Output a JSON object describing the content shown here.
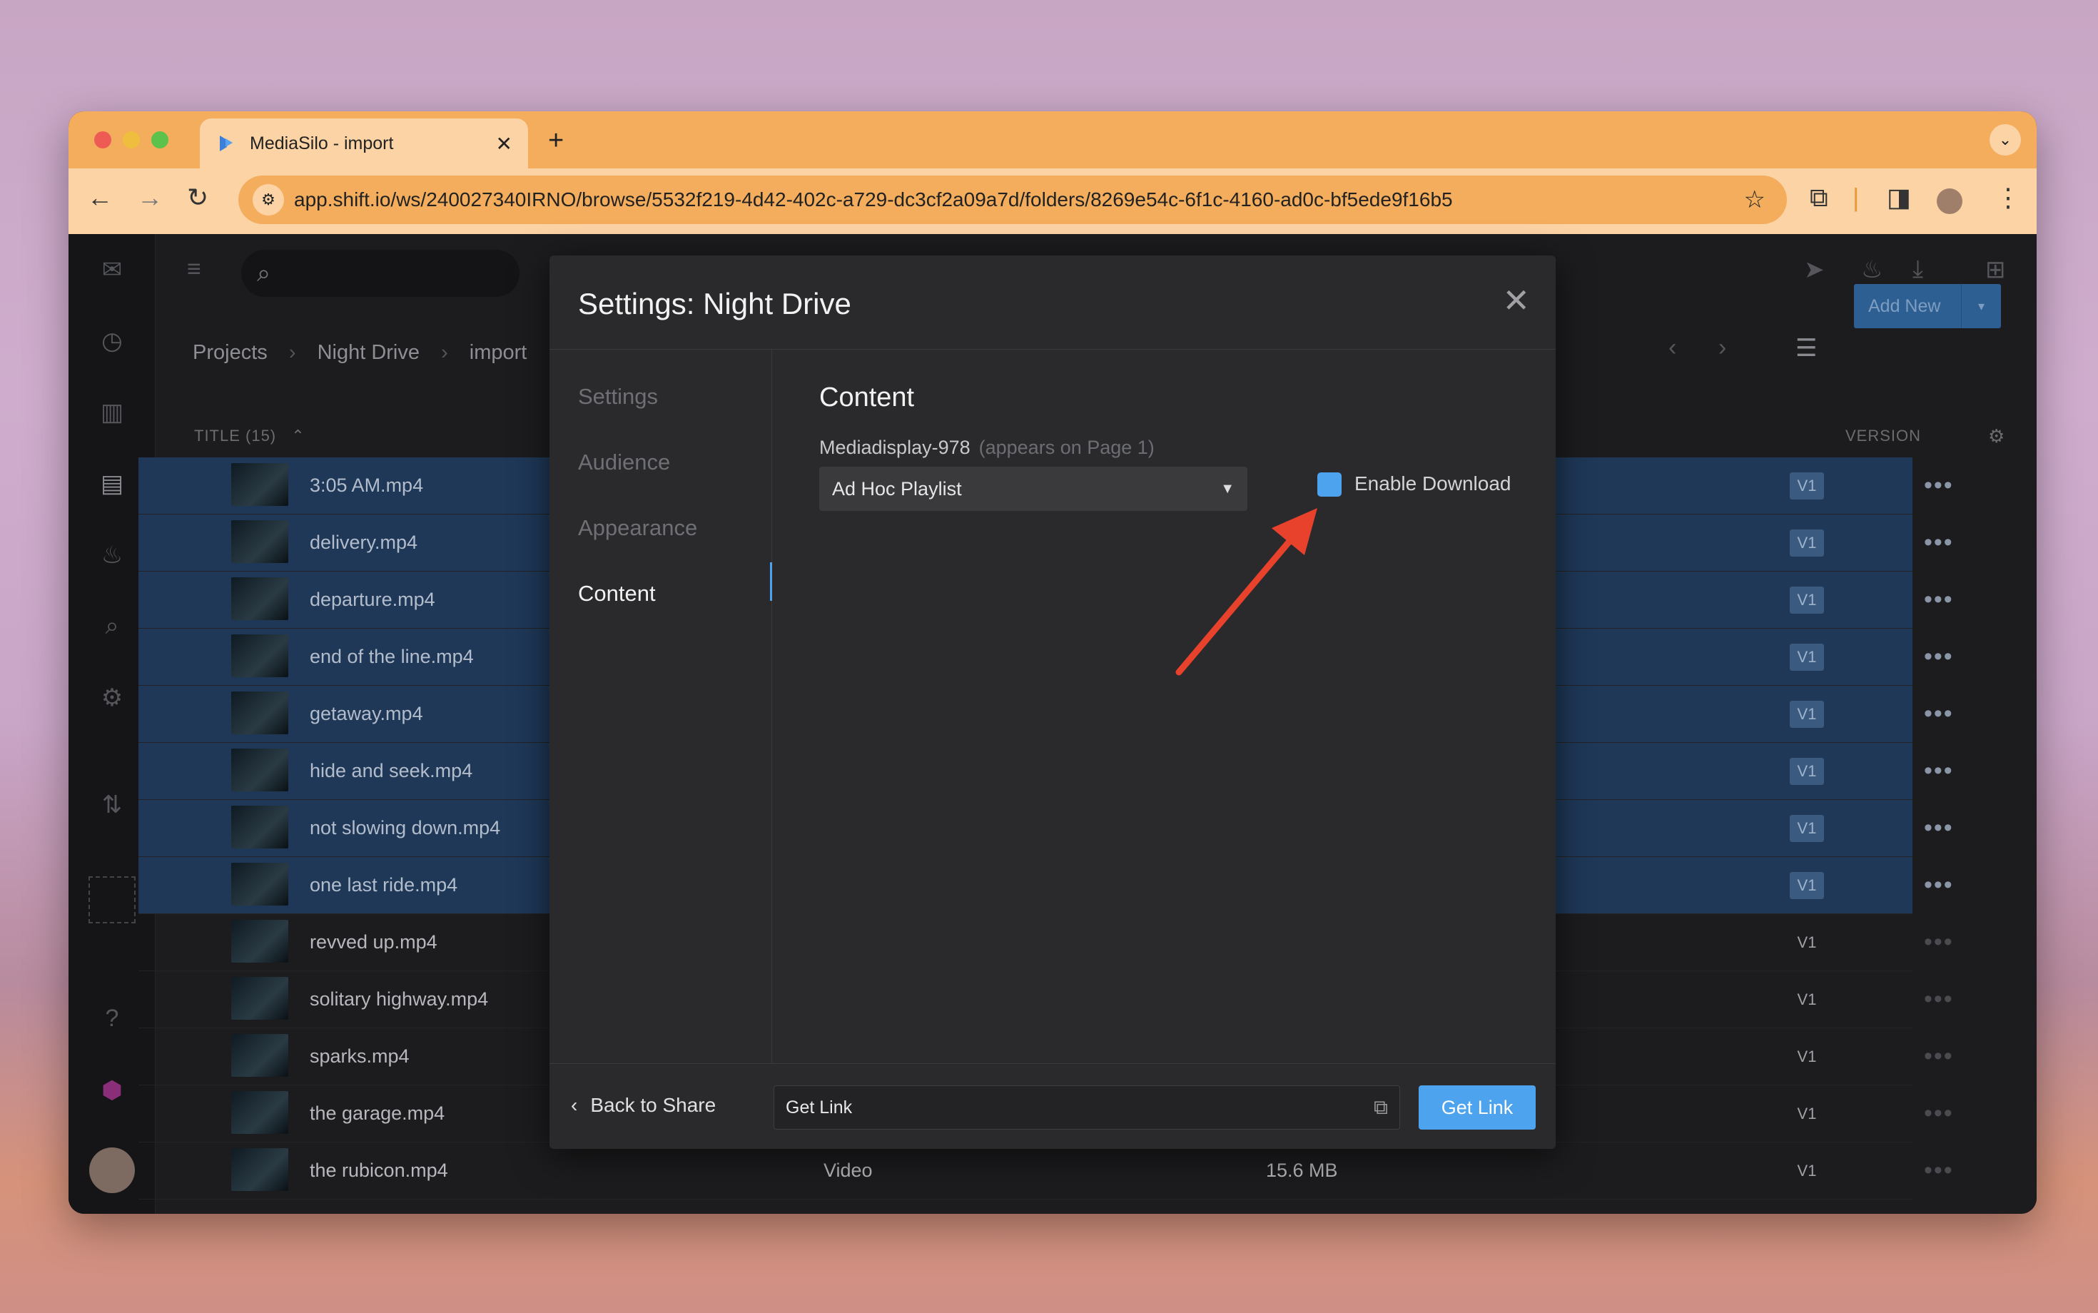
{
  "browser": {
    "tab_title": "MediaSilo - import",
    "tab_close": "✕",
    "new_tab": "+",
    "url": "app.shift.io/ws/240027340IRNO/browse/5532f219-4d42-402c-a729-dc3cf2a09a7d/folders/8269e54c-6f1c-4160-ad0c-bf5ede9f16b5"
  },
  "breadcrumb": {
    "items": [
      "Projects",
      "Night Drive",
      "import"
    ],
    "separator": "›"
  },
  "table": {
    "title_header": "TITLE (15)",
    "version_header": "VERSION",
    "rows": [
      {
        "name": "3:05 AM.mp4",
        "version": "V1",
        "selected": true
      },
      {
        "name": "delivery.mp4",
        "version": "V1",
        "selected": true
      },
      {
        "name": "departure.mp4",
        "version": "V1",
        "selected": true
      },
      {
        "name": "end of the line.mp4",
        "version": "V1",
        "selected": true
      },
      {
        "name": "getaway.mp4",
        "version": "V1",
        "selected": true
      },
      {
        "name": "hide and seek.mp4",
        "version": "V1",
        "selected": true
      },
      {
        "name": "not slowing down.mp4",
        "version": "V1",
        "selected": true
      },
      {
        "name": "one last ride.mp4",
        "version": "V1",
        "selected": true
      },
      {
        "name": "revved up.mp4",
        "version": "V1",
        "selected": false
      },
      {
        "name": "solitary highway.mp4",
        "version": "V1",
        "selected": false
      },
      {
        "name": "sparks.mp4",
        "version": "V1",
        "selected": false
      },
      {
        "name": "the garage.mp4",
        "version": "V1",
        "selected": false
      },
      {
        "name": "the rubicon.mp4",
        "version": "V1",
        "selected": false,
        "type": "Video",
        "size": "15.6 MB"
      }
    ]
  },
  "toolbar": {
    "add_new": "Add New"
  },
  "modal": {
    "title": "Settings: Night Drive",
    "close": "✕",
    "nav": [
      "Settings",
      "Audience",
      "Appearance",
      "Content"
    ],
    "active_nav": "Content",
    "section_title": "Content",
    "field_label": "Mediadisplay-978",
    "field_hint": "(appears on Page 1)",
    "dropdown_value": "Ad Hoc Playlist",
    "checkbox_label": "Enable Download",
    "back_label": "Back to Share",
    "link_field_value": "Get Link",
    "get_link_button": "Get Link"
  },
  "colors": {
    "accent": "#4da3ee",
    "annotation_arrow": "#e8412c",
    "selected_row": "#1f3858"
  }
}
